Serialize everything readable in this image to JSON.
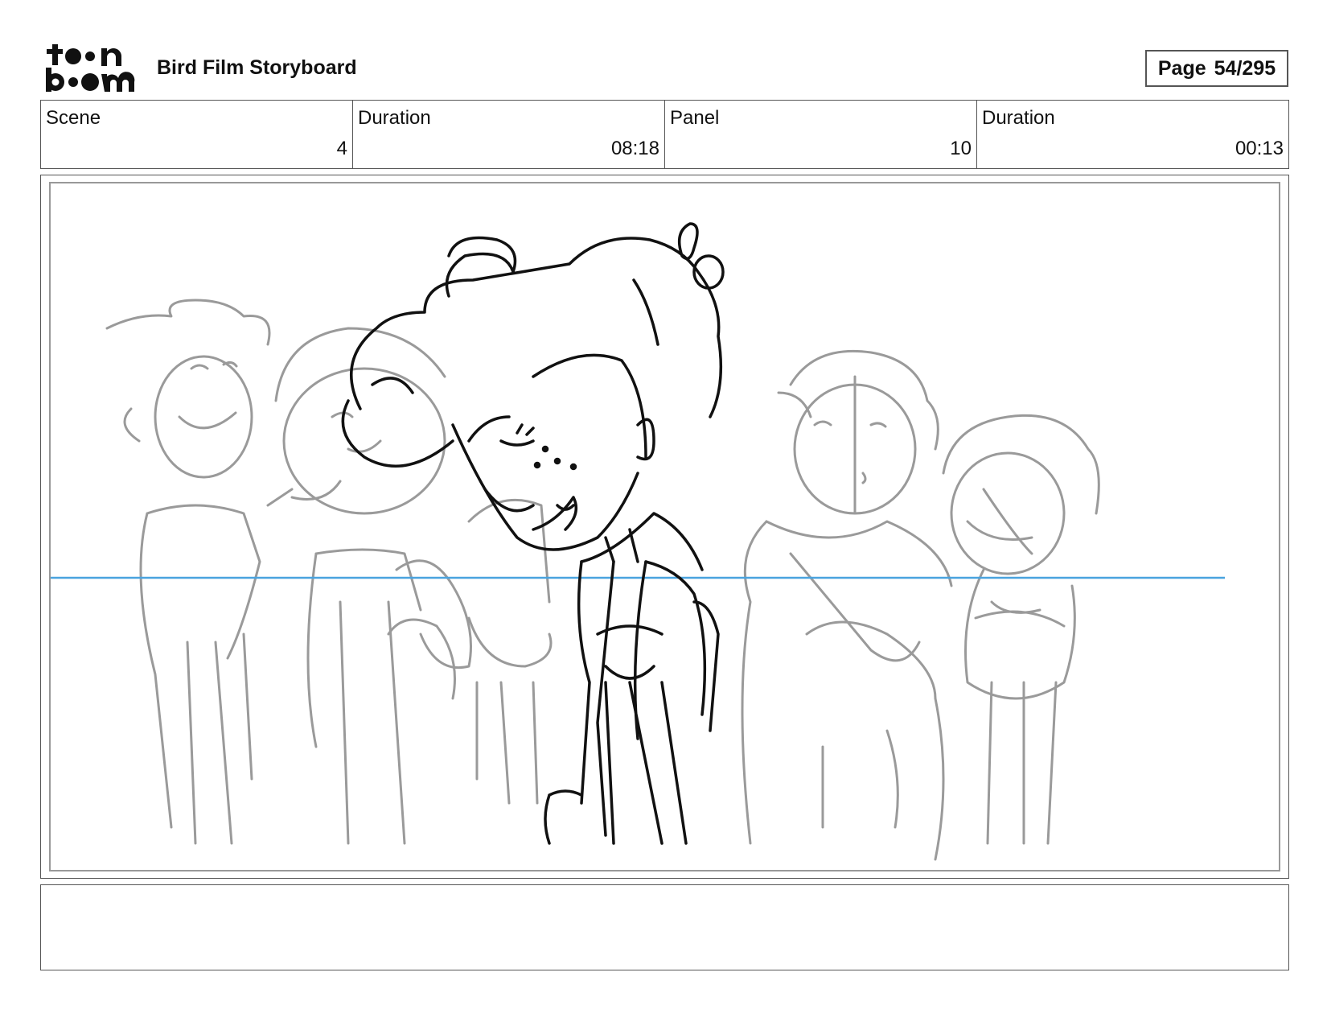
{
  "header": {
    "logo_text": "toon boom",
    "title": "Bird Film Storyboard",
    "page_label": "Page",
    "page_number": "54/295"
  },
  "info": {
    "scene_label": "Scene",
    "scene_value": "4",
    "scene_duration_label": "Duration",
    "scene_duration_value": "08:18",
    "panel_label": "Panel",
    "panel_value": "10",
    "panel_duration_label": "Duration",
    "panel_duration_value": "00:13"
  },
  "panel": {
    "sketch_subject": "boy with eyes closed, smiling, walking past a crowd of rough grey sketched people",
    "horizon_color": "#4aa3df",
    "main_line_color": "#111111",
    "background_line_color": "#9a9a9a"
  },
  "caption": {
    "text": ""
  }
}
